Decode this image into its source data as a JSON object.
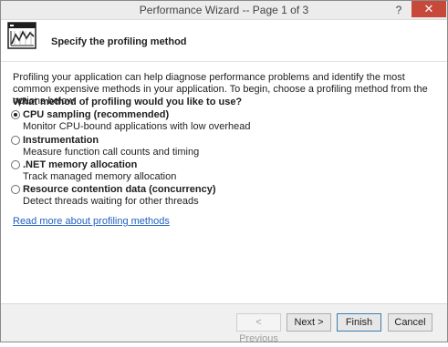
{
  "window": {
    "title": "Performance Wizard -- Page 1 of 3",
    "help_glyph": "?",
    "close_glyph": "✕"
  },
  "header": {
    "title": "Specify the profiling method",
    "icon": "performance-chart-icon"
  },
  "intro": "Profiling your application can help diagnose performance problems and identify the most common expensive methods in your application. To begin, choose a profiling method from the options below.",
  "question": "What method of profiling would you like to use?",
  "options": [
    {
      "label": "CPU sampling (recommended)",
      "desc": "Monitor CPU-bound applications with low overhead",
      "selected": true
    },
    {
      "label": "Instrumentation",
      "desc": "Measure function call counts and timing",
      "selected": false
    },
    {
      "label": ".NET memory allocation",
      "desc": "Track managed memory allocation",
      "selected": false
    },
    {
      "label": "Resource contention data (concurrency)",
      "desc": "Detect threads waiting for other threads",
      "selected": false
    }
  ],
  "link": "Read more about profiling methods",
  "buttons": {
    "previous": "< Previous",
    "next": "Next >",
    "finish": "Finish",
    "cancel": "Cancel"
  },
  "colors": {
    "close": "#c7493a",
    "link": "#1f5fbf"
  }
}
